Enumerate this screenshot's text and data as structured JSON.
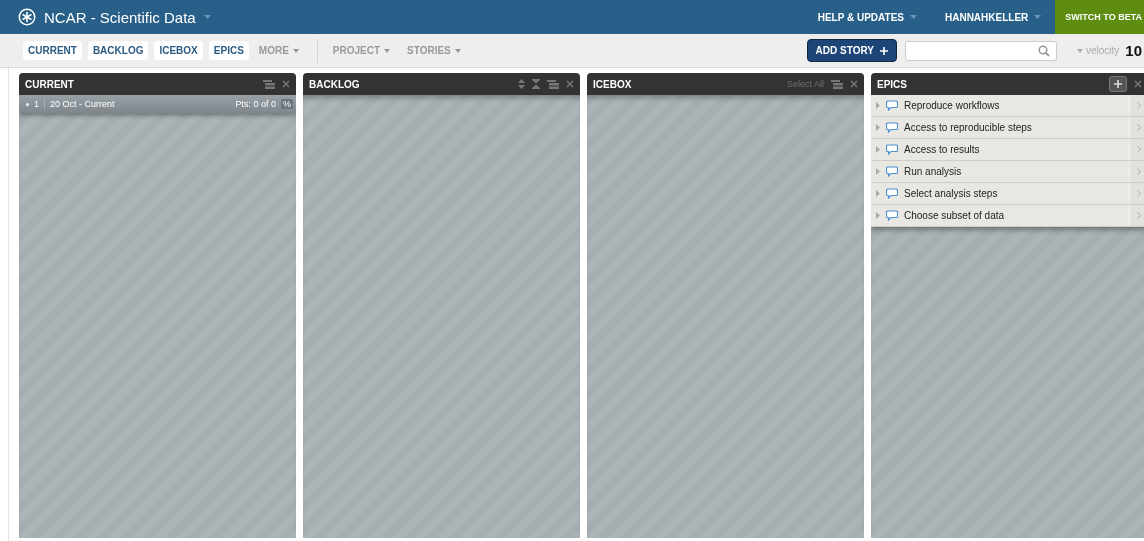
{
  "project": {
    "title": "NCAR - Scientific Data"
  },
  "top_links": [
    {
      "label": "HELP & UPDATES",
      "kind": "menu"
    },
    {
      "label": "HANNAHKELLER",
      "kind": "menu"
    },
    {
      "label": "SWITCH TO BETA",
      "kind": "beta"
    }
  ],
  "panel_toggles": [
    {
      "label": "CURRENT",
      "selected": true
    },
    {
      "label": "BACKLOG",
      "selected": true
    },
    {
      "label": "ICEBOX",
      "selected": true
    },
    {
      "label": "EPICS",
      "selected": true
    }
  ],
  "menus": [
    {
      "label": "MORE"
    },
    {
      "label": "PROJECT"
    },
    {
      "label": "STORIES"
    }
  ],
  "add_story": {
    "label": "ADD STORY"
  },
  "velocity": {
    "label": "velocity",
    "value": "10"
  },
  "panels": [
    {
      "title": "CURRENT",
      "controls": [
        {
          "kind": "stack"
        },
        {
          "kind": "close"
        }
      ],
      "iteration": {
        "number": "1",
        "dates": "20 Oct - Current",
        "points": "Pts: 0 of 0",
        "percent": "%"
      }
    },
    {
      "title": "BACKLOG",
      "controls": [
        {
          "kind": "sort"
        },
        {
          "kind": "collapse"
        },
        {
          "kind": "stack"
        },
        {
          "kind": "close"
        }
      ]
    },
    {
      "title": "ICEBOX",
      "select_all": "Select All",
      "controls": [
        {
          "kind": "stack"
        },
        {
          "kind": "close"
        }
      ]
    },
    {
      "title": "EPICS",
      "controls": [
        {
          "kind": "add"
        },
        {
          "kind": "close"
        }
      ],
      "epics": [
        {
          "name": "Reproduce workflows"
        },
        {
          "name": "Access to reproducible steps"
        },
        {
          "name": "Access to results"
        },
        {
          "name": "Run analysis"
        },
        {
          "name": "Select analysis steps"
        },
        {
          "name": "Choose subset of data"
        }
      ]
    }
  ]
}
